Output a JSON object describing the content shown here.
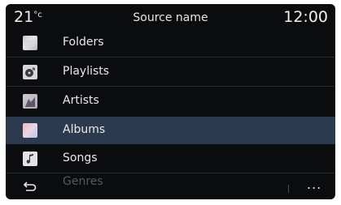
{
  "status": {
    "temperature": "21",
    "temperature_unit": "°c",
    "title": "Source name",
    "time": "12:00"
  },
  "list": {
    "items": [
      {
        "label": "Folders",
        "icon": "folder-thumbnail"
      },
      {
        "label": "Playlists",
        "icon": "playlist-thumbnail"
      },
      {
        "label": "Artists",
        "icon": "artist-thumbnail"
      },
      {
        "label": "Albums",
        "icon": "album-thumbnail",
        "selected": true
      },
      {
        "label": "Songs",
        "icon": "song-thumbnail"
      }
    ],
    "partial_item": "Genres"
  },
  "bottom": {
    "back_icon": "back-arrow-icon",
    "more_label": "..."
  },
  "colors": {
    "background": "#0b0c0e",
    "selected_row": "#2b3a4f",
    "text": "#e8e8ea"
  }
}
